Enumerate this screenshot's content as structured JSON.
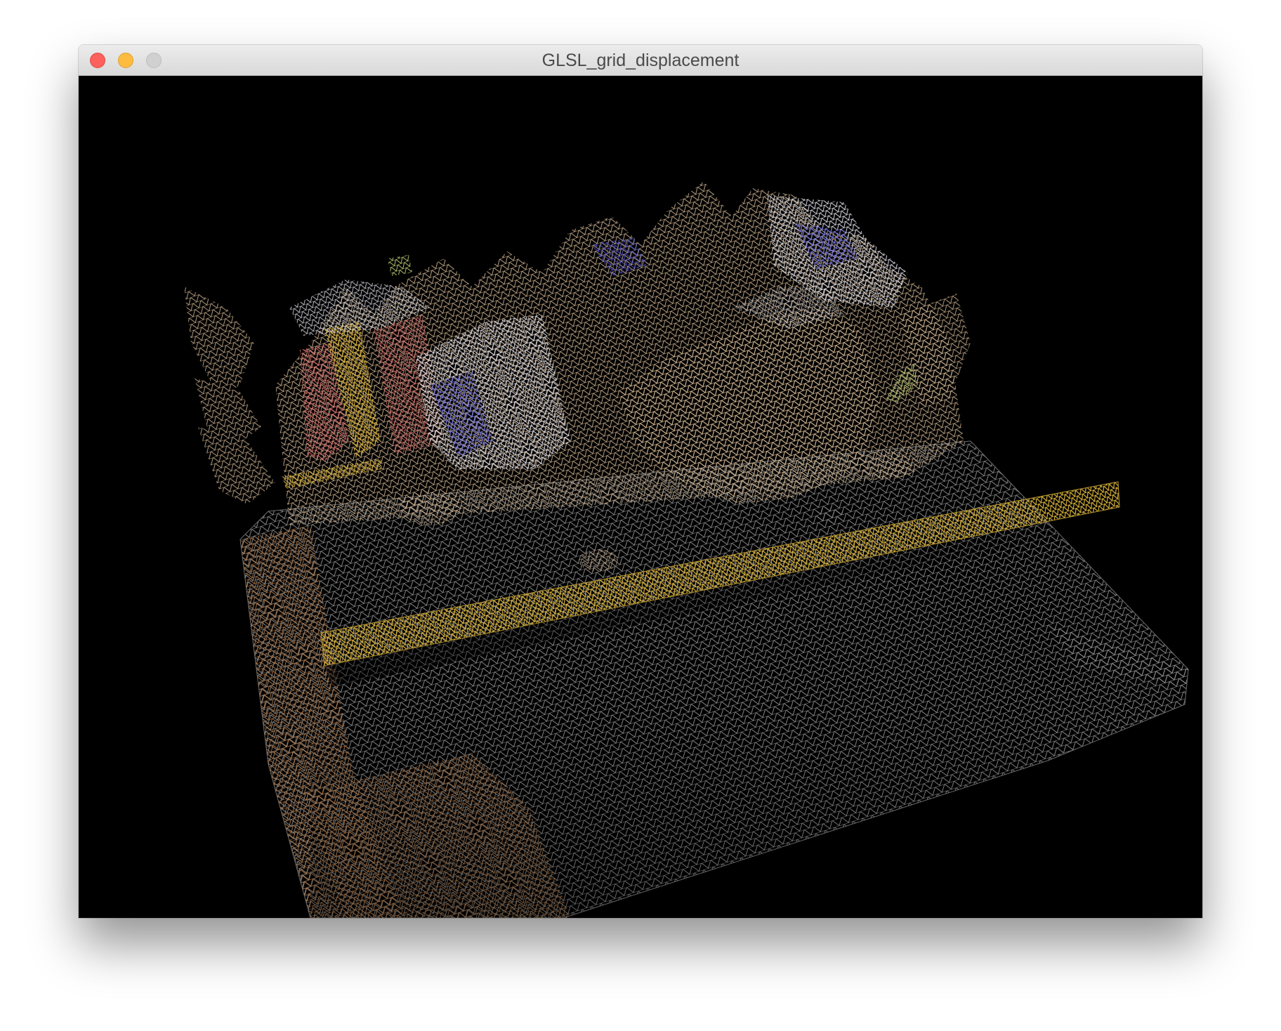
{
  "window": {
    "title": "GLSL_grid_displacement"
  },
  "colors": {
    "background": "#000000",
    "mesh_gray": "#8a8a8a",
    "mesh_tan": "#c8ae8c",
    "mesh_gold": "#d9b23a",
    "mesh_white": "#e4e4ee",
    "mesh_blue": "#5a5ce0",
    "mesh_red": "#e07070",
    "mesh_copper": "#b07a4a",
    "close_button": "#fc615d",
    "minimize_button": "#fdbc40",
    "zoom_button": "#d0d0d0"
  }
}
